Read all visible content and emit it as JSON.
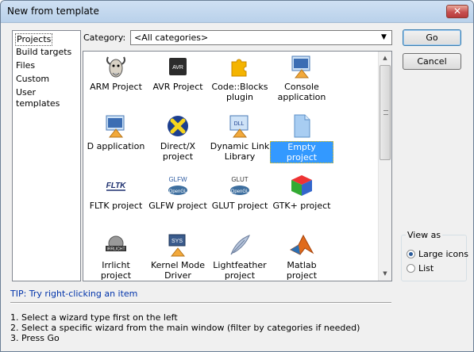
{
  "window": {
    "title": "New from template",
    "close_glyph": "✕"
  },
  "left_list": {
    "items": [
      "Projects",
      "Build targets",
      "Files",
      "Custom",
      "User templates"
    ],
    "selected_index": 0
  },
  "category": {
    "label": "Category:",
    "value": "<All categories>"
  },
  "templates": [
    {
      "label1": "ARM Project",
      "label2": "",
      "icon": "gnu-icon"
    },
    {
      "label1": "AVR Project",
      "label2": "",
      "icon": "avr-icon"
    },
    {
      "label1": "Code::Blocks",
      "label2": "plugin",
      "icon": "puzzle-icon"
    },
    {
      "label1": "Console",
      "label2": "application",
      "icon": "console-icon"
    },
    {
      "label1": "D application",
      "label2": "",
      "icon": "d-app-icon"
    },
    {
      "label1": "Direct/X",
      "label2": "project",
      "icon": "directx-icon"
    },
    {
      "label1": "Dynamic Link",
      "label2": "Library",
      "icon": "dll-icon"
    },
    {
      "label1": "Empty project",
      "label2": "",
      "icon": "empty-project-icon",
      "selected": true
    },
    {
      "label1": "FLTK project",
      "label2": "",
      "icon": "fltk-icon"
    },
    {
      "label1": "GLFW project",
      "label2": "",
      "icon": "glfw-icon"
    },
    {
      "label1": "GLUT project",
      "label2": "",
      "icon": "glut-icon"
    },
    {
      "label1": "GTK+ project",
      "label2": "",
      "icon": "gtk-icon"
    },
    {
      "label1": "Irrlicht project",
      "label2": "",
      "icon": "irrlicht-icon"
    },
    {
      "label1": "Kernel Mode",
      "label2": "Driver",
      "icon": "sys-icon"
    },
    {
      "label1": "Lightfeather",
      "label2": "project",
      "icon": "feather-icon"
    },
    {
      "label1": "Matlab project",
      "label2": "",
      "icon": "matlab-icon"
    }
  ],
  "icon_text": {
    "avr": "AVR",
    "dll": "DLL",
    "fltk": "FLTK",
    "glfw": "GLFW",
    "glut": "GLUT",
    "opengl": "OpenGL",
    "irrlicht": "IRRLICHT",
    "sys": "SYS"
  },
  "buttons": {
    "go": "Go",
    "cancel": "Cancel"
  },
  "view_as": {
    "legend": "View as",
    "options": [
      "Large icons",
      "List"
    ],
    "selected": "Large icons"
  },
  "tip": "TIP: Try right-clicking an item",
  "steps": [
    "1. Select a wizard type first on the left",
    "2. Select a specific wizard from the main window (filter by categories if needed)",
    "3. Press Go"
  ],
  "colors": {
    "selection": "#3399ff",
    "tip": "#0033aa",
    "title_bar": "#cfe0f3"
  }
}
